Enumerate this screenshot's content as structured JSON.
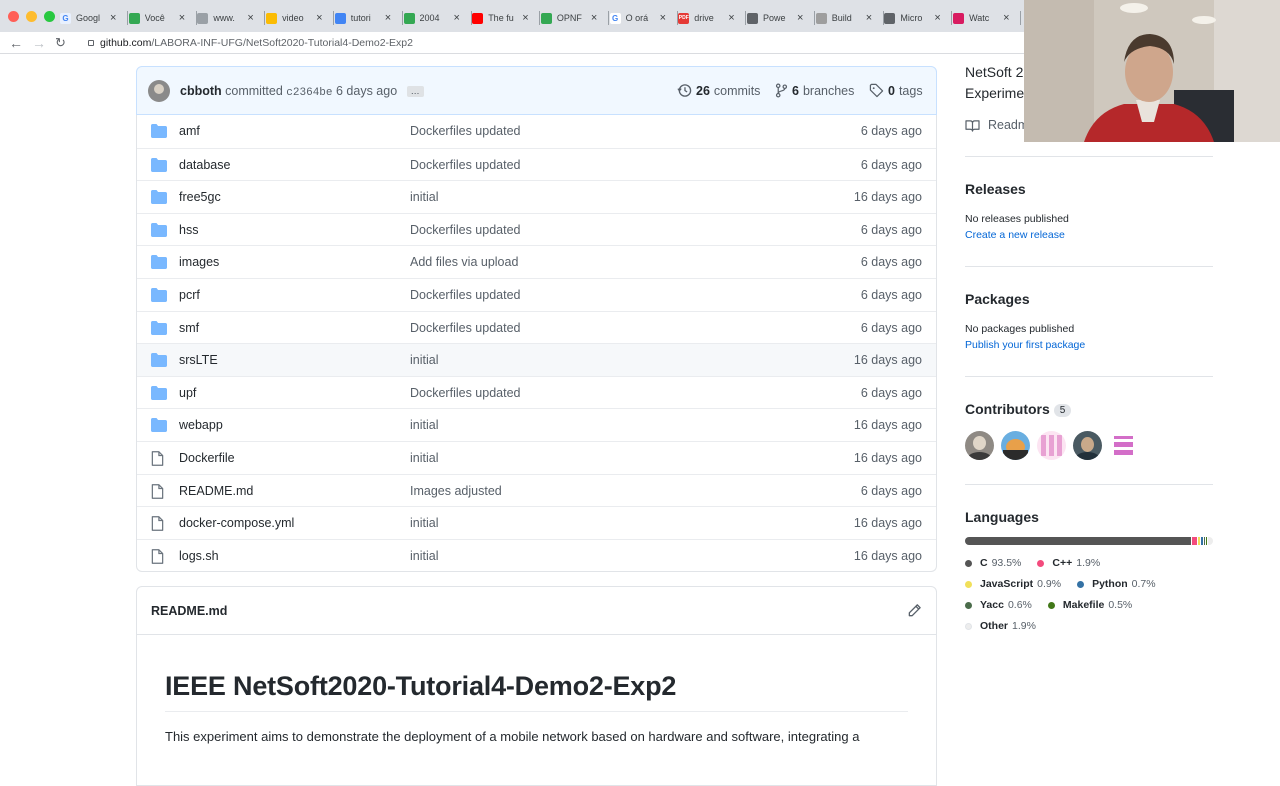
{
  "browser": {
    "tabs": [
      {
        "title": "Googl",
        "color": "#4285f4",
        "glyph": "G"
      },
      {
        "title": "Você",
        "color": "#34a853",
        "glyph": ""
      },
      {
        "title": "www.",
        "color": "#9aa0a6",
        "glyph": ""
      },
      {
        "title": "video",
        "color": "#fbbc04",
        "glyph": ""
      },
      {
        "title": "tutori",
        "color": "#4285f4",
        "glyph": ""
      },
      {
        "title": "2004",
        "color": "#34a853",
        "glyph": ""
      },
      {
        "title": "The fu",
        "color": "#ff0000",
        "glyph": ""
      },
      {
        "title": "OPNF",
        "color": "#34a853",
        "glyph": ""
      },
      {
        "title": "O orá",
        "color": "#ffffff",
        "glyph": "G"
      },
      {
        "title": "drive",
        "color": "#e53935",
        "glyph": "PDF"
      },
      {
        "title": "Powe",
        "color": "#5f6368",
        "glyph": ""
      },
      {
        "title": "Build",
        "color": "#9e9e9e",
        "glyph": ""
      },
      {
        "title": "Micro",
        "color": "#5f6368",
        "glyph": ""
      },
      {
        "title": "Watc",
        "color": "#d81b60",
        "glyph": ""
      }
    ],
    "url_host": "github.com",
    "url_path": "/LABORA-INF-UFG/NetSoft2020-Tutorial4-Demo2-Exp2"
  },
  "commit": {
    "author": "cbboth",
    "verb": "committed",
    "sha": "c2364be",
    "when": "6 days ago",
    "dots": "…",
    "commits_count": "26",
    "commits_label": "commits",
    "branches_count": "6",
    "branches_label": "branches",
    "tags_count": "0",
    "tags_label": "tags"
  },
  "files": [
    {
      "name": "amf",
      "type": "dir",
      "message": "Dockerfiles updated",
      "age": "6 days ago"
    },
    {
      "name": "database",
      "type": "dir",
      "message": "Dockerfiles updated",
      "age": "6 days ago"
    },
    {
      "name": "free5gc",
      "type": "dir",
      "message": "initial",
      "age": "16 days ago"
    },
    {
      "name": "hss",
      "type": "dir",
      "message": "Dockerfiles updated",
      "age": "6 days ago"
    },
    {
      "name": "images",
      "type": "dir",
      "message": "Add files via upload",
      "age": "6 days ago"
    },
    {
      "name": "pcrf",
      "type": "dir",
      "message": "Dockerfiles updated",
      "age": "6 days ago"
    },
    {
      "name": "smf",
      "type": "dir",
      "message": "Dockerfiles updated",
      "age": "6 days ago"
    },
    {
      "name": "srsLTE",
      "type": "dir",
      "message": "initial",
      "age": "16 days ago"
    },
    {
      "name": "upf",
      "type": "dir",
      "message": "Dockerfiles updated",
      "age": "6 days ago"
    },
    {
      "name": "webapp",
      "type": "dir",
      "message": "initial",
      "age": "16 days ago"
    },
    {
      "name": "Dockerfile",
      "type": "file",
      "message": "initial",
      "age": "16 days ago"
    },
    {
      "name": "README.md",
      "type": "file",
      "message": "Images adjusted",
      "age": "6 days ago"
    },
    {
      "name": "docker-compose.yml",
      "type": "file",
      "message": "initial",
      "age": "16 days ago"
    },
    {
      "name": "logs.sh",
      "type": "file",
      "message": "initial",
      "age": "16 days ago"
    }
  ],
  "readme": {
    "header": "README.md",
    "title": "IEEE NetSoft2020-Tutorial4-Demo2-Exp2",
    "intro": "This experiment aims to demonstrate the deployment of a mobile network based on hardware and software, integrating a"
  },
  "sidebar": {
    "about_line1": "NetSoft 2",
    "about_line2": "Experimen",
    "readme_link": "Readm",
    "releases_title": "Releases",
    "releases_none": "No releases published",
    "releases_link": "Create a new release",
    "packages_title": "Packages",
    "packages_none": "No packages published",
    "packages_link": "Publish your first package",
    "contributors_title": "Contributors",
    "contributors_count": "5",
    "languages_title": "Languages",
    "languages": [
      {
        "name": "C",
        "percent": "93.5%",
        "value": 93.5,
        "color": "#555555"
      },
      {
        "name": "C++",
        "percent": "1.9%",
        "value": 1.9,
        "color": "#f34b7d"
      },
      {
        "name": "JavaScript",
        "percent": "0.9%",
        "value": 0.9,
        "color": "#f1e05a"
      },
      {
        "name": "Python",
        "percent": "0.7%",
        "value": 0.7,
        "color": "#3572a5"
      },
      {
        "name": "Yacc",
        "percent": "0.6%",
        "value": 0.6,
        "color": "#4b6c4b"
      },
      {
        "name": "Makefile",
        "percent": "0.5%",
        "value": 0.5,
        "color": "#427819"
      },
      {
        "name": "Other",
        "percent": "1.9%",
        "value": 1.9,
        "color": "#ededed"
      }
    ]
  }
}
